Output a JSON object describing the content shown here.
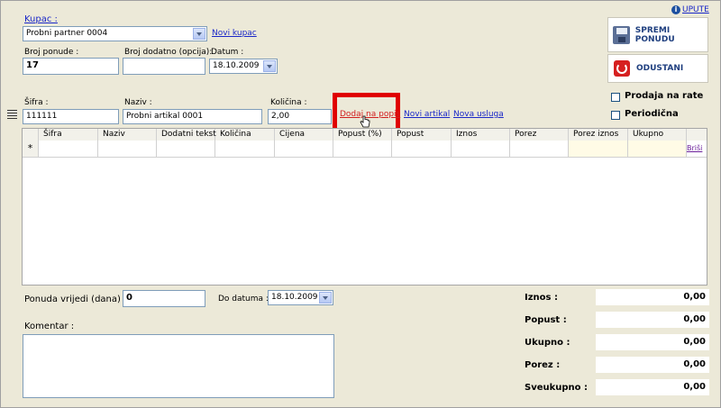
{
  "help_link": "UPUTE",
  "customer": {
    "label": "Kupac :",
    "value": "Probni partner 0004",
    "new_link": "Novi kupac"
  },
  "offer_number": {
    "label": "Broj ponude :",
    "value": "17"
  },
  "extra_number": {
    "label": "Broj dodatno (opcija):",
    "value": ""
  },
  "date": {
    "label": "Datum :",
    "value": "18.10.2009"
  },
  "buttons": {
    "save": "SPREMI PONUDU",
    "cancel": "ODUSTANI"
  },
  "checkboxes": {
    "installment": "Prodaja na rate",
    "periodic": "Periodična"
  },
  "item_entry": {
    "code_label": "Šifra :",
    "code_value": "111111",
    "name_label": "Naziv :",
    "name_value": "Probni artikal 0001",
    "qty_label": "Količina :",
    "qty_value": "2,00",
    "add_link": "Dodaj na popis",
    "new_article_link": "Novi artikal",
    "new_service_link": "Nova usluga"
  },
  "grid": {
    "columns": [
      "Šifra",
      "Naziv",
      "Dodatni tekst",
      "Količina",
      "Cijena",
      "Popust (%)",
      "Popust",
      "Iznos",
      "Porez",
      "Porez iznos",
      "Ukupno"
    ],
    "new_row_marker": "*",
    "delete_link": "Briši"
  },
  "validity": {
    "label": "Ponuda vrijedi (dana) :",
    "value": "0"
  },
  "until_date": {
    "label": "Do datuma :",
    "value": "18.10.2009"
  },
  "comment": {
    "label": "Komentar :",
    "value": ""
  },
  "summary": [
    {
      "label": "Iznos :",
      "value": "0,00"
    },
    {
      "label": "Popust :",
      "value": "0,00"
    },
    {
      "label": "Ukupno :",
      "value": "0,00"
    },
    {
      "label": "Porez :",
      "value": "0,00"
    },
    {
      "label": "Sveukupno :",
      "value": "0,00"
    }
  ],
  "colors": {
    "link": "#1a27c8",
    "highlight": "#e00000",
    "visited_link": "#d21f1f",
    "cancel_icon": "#d62020",
    "save_text": "#1f3f7f"
  }
}
